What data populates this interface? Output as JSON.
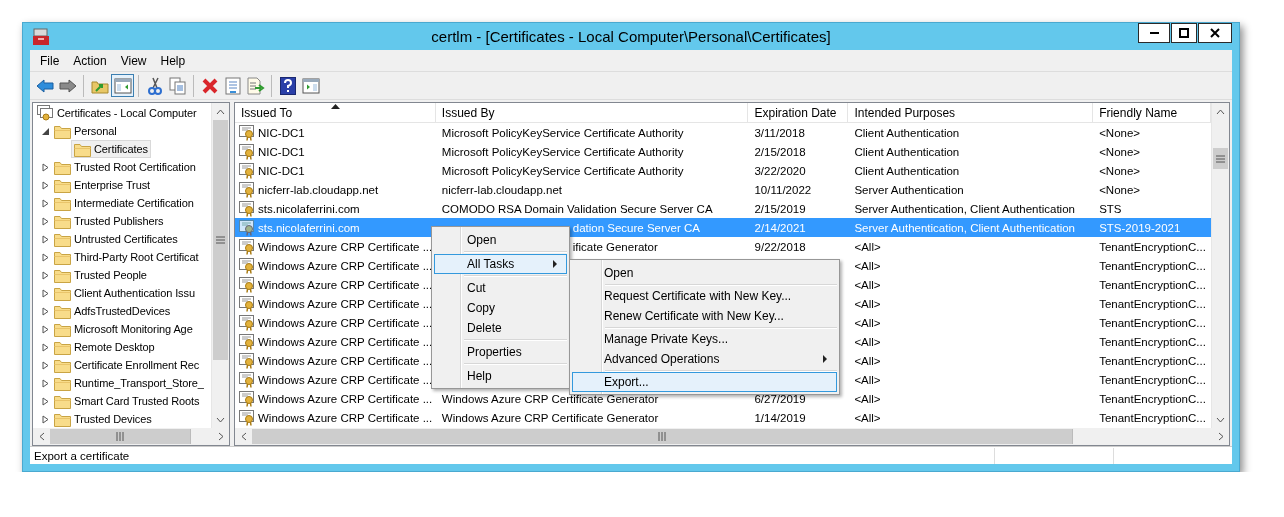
{
  "window": {
    "title": "certlm - [Certificates - Local Computer\\Personal\\Certificates]"
  },
  "menu_bar": [
    "File",
    "Action",
    "View",
    "Help"
  ],
  "toolbar": [
    {
      "kind": "back",
      "pressed": false
    },
    {
      "kind": "forward",
      "pressed": false
    },
    {
      "kind": "separator"
    },
    {
      "kind": "up",
      "pressed": false
    },
    {
      "kind": "tree",
      "pressed": true
    },
    {
      "kind": "separator"
    },
    {
      "kind": "cut",
      "pressed": false
    },
    {
      "kind": "copy",
      "pressed": false
    },
    {
      "kind": "separator"
    },
    {
      "kind": "delete",
      "pressed": false
    },
    {
      "kind": "properties",
      "pressed": false
    },
    {
      "kind": "export",
      "pressed": false
    },
    {
      "kind": "separator"
    },
    {
      "kind": "help",
      "pressed": false
    },
    {
      "kind": "actionpane",
      "pressed": false
    }
  ],
  "tree": [
    {
      "label": "Certificates - Local Computer",
      "kind": "store",
      "selected": false,
      "children": [
        {
          "label": "Personal",
          "kind": "folder",
          "expanded": true,
          "selected": false,
          "children": [
            {
              "label": "Certificates",
              "kind": "folder",
              "selected": true
            }
          ]
        },
        {
          "label": "Trusted Root Certification",
          "kind": "folder",
          "expanded": false,
          "selected": false
        },
        {
          "label": "Enterprise Trust",
          "kind": "folder",
          "expanded": false,
          "selected": false
        },
        {
          "label": "Intermediate Certification",
          "kind": "folder",
          "expanded": false,
          "selected": false
        },
        {
          "label": "Trusted Publishers",
          "kind": "folder",
          "expanded": false,
          "selected": false
        },
        {
          "label": "Untrusted Certificates",
          "kind": "folder",
          "expanded": false,
          "selected": false
        },
        {
          "label": "Third-Party Root Certificat",
          "kind": "folder",
          "expanded": false,
          "selected": false
        },
        {
          "label": "Trusted People",
          "kind": "folder",
          "expanded": false,
          "selected": false
        },
        {
          "label": "Client Authentication Issu",
          "kind": "folder",
          "expanded": false,
          "selected": false
        },
        {
          "label": "AdfsTrustedDevices",
          "kind": "folder",
          "expanded": false,
          "selected": false
        },
        {
          "label": "Microsoft Monitoring Age",
          "kind": "folder",
          "expanded": false,
          "selected": false
        },
        {
          "label": "Remote Desktop",
          "kind": "folder",
          "expanded": false,
          "selected": false
        },
        {
          "label": "Certificate Enrollment Rec",
          "kind": "folder",
          "expanded": false,
          "selected": false
        },
        {
          "label": "Runtime_Transport_Store_",
          "kind": "folder",
          "expanded": false,
          "selected": false
        },
        {
          "label": "Smart Card Trusted Roots",
          "kind": "folder",
          "expanded": false,
          "selected": false
        },
        {
          "label": "Trusted Devices",
          "kind": "folder",
          "expanded": false,
          "selected": false
        }
      ]
    }
  ],
  "table": {
    "columns": [
      {
        "label": "Issued To",
        "sorted": true
      },
      {
        "label": "Issued By",
        "sorted": false
      },
      {
        "label": "Expiration Date",
        "sorted": false
      },
      {
        "label": "Intended Purposes",
        "sorted": false
      },
      {
        "label": "Friendly Name",
        "sorted": false
      }
    ],
    "rows": [
      {
        "issued_to": "NIC-DC1",
        "issued_by": "Microsoft PolicyKeyService Certificate Authority",
        "expiration": "3/11/2018",
        "purposes": "Client Authentication",
        "friendly_name": "<None>",
        "selected": false
      },
      {
        "issued_to": "NIC-DC1",
        "issued_by": "Microsoft PolicyKeyService Certificate Authority",
        "expiration": "2/15/2018",
        "purposes": "Client Authentication",
        "friendly_name": "<None>",
        "selected": false
      },
      {
        "issued_to": "NIC-DC1",
        "issued_by": "Microsoft PolicyKeyService Certificate Authority",
        "expiration": "3/22/2020",
        "purposes": "Client Authentication",
        "friendly_name": "<None>",
        "selected": false
      },
      {
        "issued_to": "nicferr-lab.cloudapp.net",
        "issued_by": "nicferr-lab.cloudapp.net",
        "expiration": "10/11/2022",
        "purposes": "Server Authentication",
        "friendly_name": "<None>",
        "selected": false
      },
      {
        "issued_to": "sts.nicolaferrini.com",
        "issued_by": "COMODO RSA Domain Validation Secure Server CA",
        "expiration": "2/15/2019",
        "purposes": "Server Authentication, Client Authentication",
        "friendly_name": "STS",
        "selected": false
      },
      {
        "issued_to": "sts.nicolaferrini.com",
        "issued_by": "dation Secure Server CA",
        "issued_by_covered": true,
        "expiration": "2/14/2021",
        "purposes": "Server Authentication, Client Authentication",
        "friendly_name": "STS-2019-2021",
        "selected": true
      },
      {
        "issued_to": "Windows Azure CRP Certificate ...",
        "issued_by": "ificate Generator",
        "issued_by_covered": true,
        "expiration": "9/22/2018",
        "purposes": "<All>",
        "friendly_name": "TenantEncryptionC...",
        "selected": false
      },
      {
        "issued_to": "Windows Azure CRP Certificate ...",
        "purposes": "<All>",
        "friendly_name": "TenantEncryptionC...",
        "selected": false
      },
      {
        "issued_to": "Windows Azure CRP Certificate ...",
        "purposes": "<All>",
        "friendly_name": "TenantEncryptionC...",
        "selected": false
      },
      {
        "issued_to": "Windows Azure CRP Certificate ...",
        "purposes": "<All>",
        "friendly_name": "TenantEncryptionC...",
        "selected": false
      },
      {
        "issued_to": "Windows Azure CRP Certificate ...",
        "purposes": "<All>",
        "friendly_name": "TenantEncryptionC...",
        "selected": false
      },
      {
        "issued_to": "Windows Azure CRP Certificate ...",
        "purposes": "<All>",
        "friendly_name": "TenantEncryptionC...",
        "selected": false
      },
      {
        "issued_to": "Windows Azure CRP Certificate ...",
        "purposes": "<All>",
        "friendly_name": "TenantEncryptionC...",
        "selected": false
      },
      {
        "issued_to": "Windows Azure CRP Certificate ...",
        "purposes": "<All>",
        "friendly_name": "TenantEncryptionC...",
        "selected": false
      },
      {
        "issued_to": "Windows Azure CRP Certificate ...",
        "issued_by": "Windows Azure CRP Certificate Generator",
        "expiration": "6/27/2019",
        "purposes": "<All>",
        "friendly_name": "TenantEncryptionC...",
        "selected": false
      },
      {
        "issued_to": "Windows Azure CRP Certificate ...",
        "issued_by": "Windows Azure CRP Certificate Generator",
        "expiration": "1/14/2019",
        "purposes": "<All>",
        "friendly_name": "TenantEncryptionC...",
        "selected": false
      }
    ]
  },
  "context_menu": {
    "items": [
      {
        "kind": "item",
        "label": "Open",
        "submenu": false,
        "selected": false
      },
      {
        "kind": "separator"
      },
      {
        "kind": "item",
        "label": "All Tasks",
        "submenu": true,
        "selected": true
      },
      {
        "kind": "separator"
      },
      {
        "kind": "item",
        "label": "Cut",
        "submenu": false,
        "selected": false
      },
      {
        "kind": "item",
        "label": "Copy",
        "submenu": false,
        "selected": false
      },
      {
        "kind": "item",
        "label": "Delete",
        "submenu": false,
        "selected": false
      },
      {
        "kind": "separator"
      },
      {
        "kind": "item",
        "label": "Properties",
        "submenu": false,
        "selected": false
      },
      {
        "kind": "separator"
      },
      {
        "kind": "item",
        "label": "Help",
        "submenu": false,
        "selected": false
      }
    ]
  },
  "submenu": {
    "items": [
      {
        "kind": "item",
        "label": "Open",
        "submenu": false,
        "selected": false
      },
      {
        "kind": "separator"
      },
      {
        "kind": "item",
        "label": "Request Certificate with New Key...",
        "submenu": false,
        "selected": false
      },
      {
        "kind": "item",
        "label": "Renew Certificate with New Key...",
        "submenu": false,
        "selected": false
      },
      {
        "kind": "separator"
      },
      {
        "kind": "item",
        "label": "Manage Private Keys...",
        "submenu": false,
        "selected": false
      },
      {
        "kind": "item",
        "label": "Advanced Operations",
        "submenu": true,
        "selected": false
      },
      {
        "kind": "separator"
      },
      {
        "kind": "item",
        "label": "Export...",
        "submenu": false,
        "selected": true
      }
    ]
  },
  "status_bar": {
    "text": "Export a certificate"
  }
}
